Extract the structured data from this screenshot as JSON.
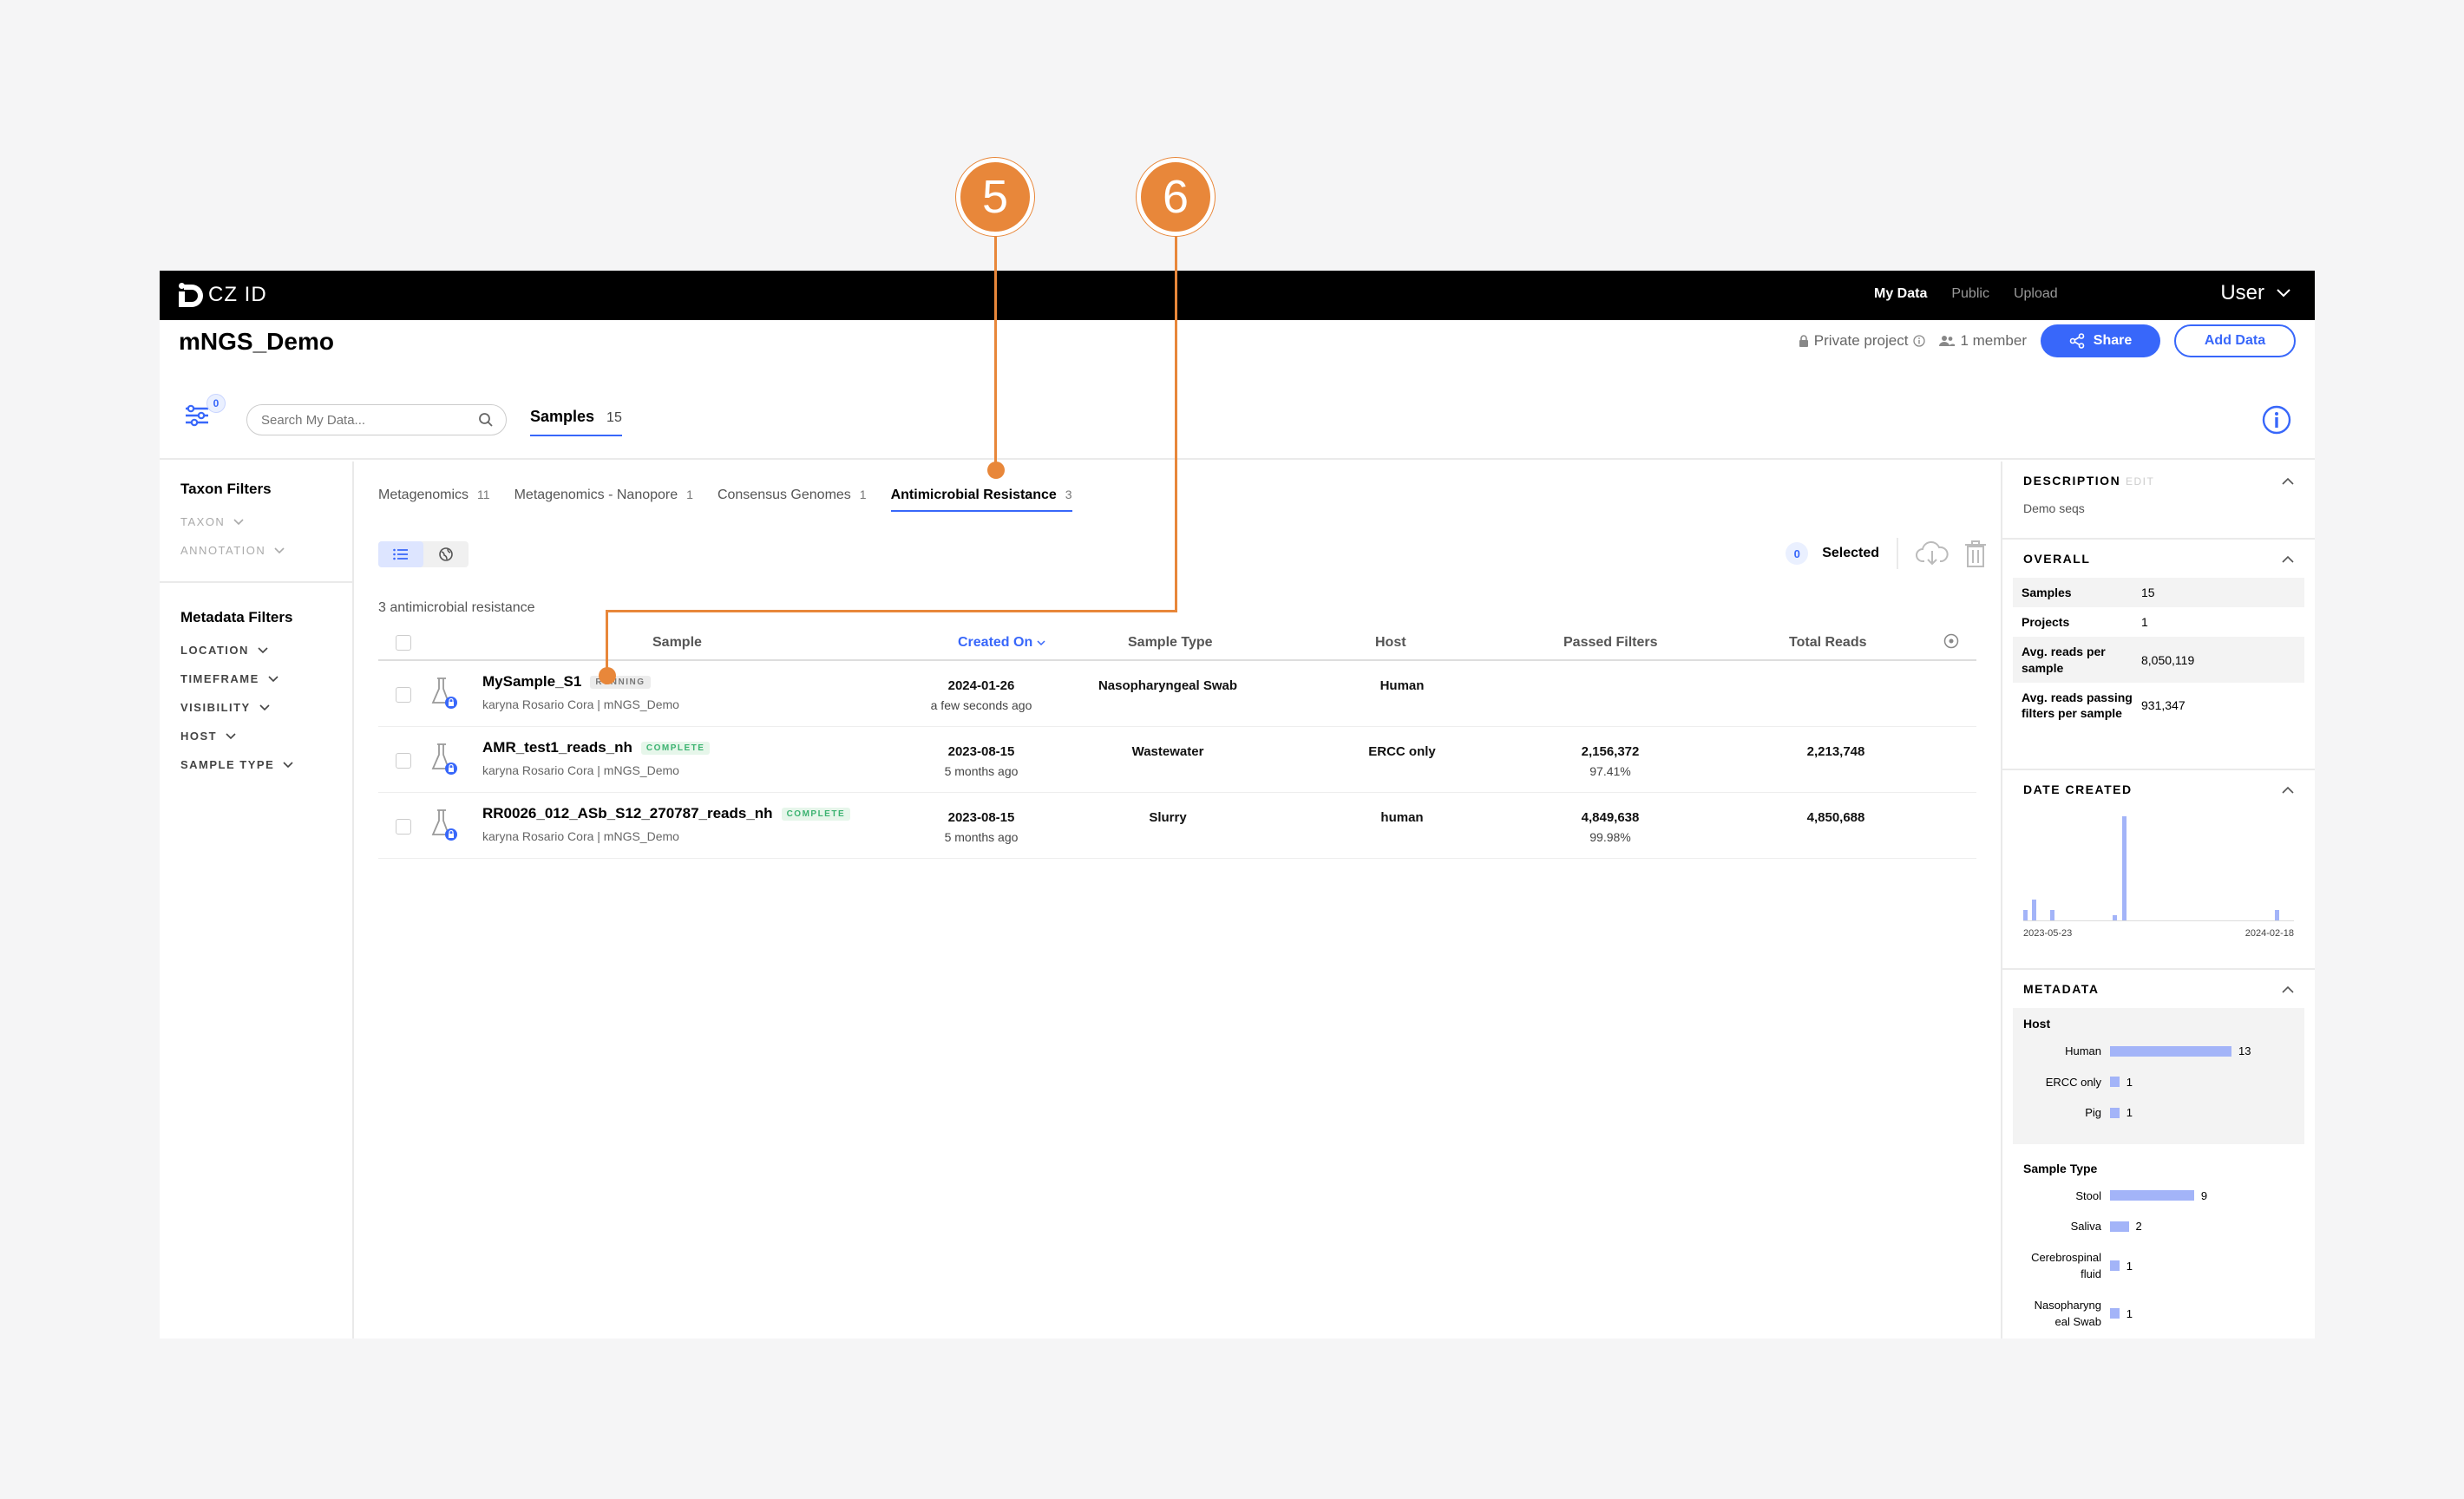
{
  "app": {
    "logo_main": "CZ",
    "logo_suffix": " ID",
    "nav": [
      "My Data",
      "Public",
      "Upload"
    ],
    "user": "User"
  },
  "project": {
    "title": "mNGS_Demo",
    "privacy": "Private project",
    "members": "1 member",
    "share_label": "Share",
    "add_data_label": "Add Data"
  },
  "toolbar": {
    "filter_count": "0",
    "search_placeholder": "Search My Data...",
    "samples_tab": "Samples",
    "samples_count": "15"
  },
  "left_panel": {
    "taxon_title": "Taxon Filters",
    "taxon_filters": [
      "TAXON",
      "ANNOTATION"
    ],
    "metadata_title": "Metadata Filters",
    "metadata_filters": [
      "LOCATION",
      "TIMEFRAME",
      "VISIBILITY",
      "HOST",
      "SAMPLE TYPE"
    ]
  },
  "workflow_tabs": [
    {
      "label": "Metagenomics",
      "count": "11"
    },
    {
      "label": "Metagenomics - Nanopore",
      "count": "1"
    },
    {
      "label": "Consensus Genomes",
      "count": "1"
    },
    {
      "label": "Antimicrobial Resistance",
      "count": "3"
    }
  ],
  "selection": {
    "count": "0",
    "label": "Selected"
  },
  "result_count": "3 antimicrobial resistance",
  "table": {
    "columns": [
      "Sample",
      "Created On",
      "Sample Type",
      "Host",
      "Passed Filters",
      "Total Reads"
    ],
    "rows": [
      {
        "name": "MySample_S1",
        "status": "RUNNING",
        "status_kind": "running",
        "sub": "karyna Rosario Cora | mNGS_Demo",
        "date": "2024-01-26",
        "ago": "a few seconds ago",
        "type": "Nasopharyngeal Swab",
        "host": "Human",
        "passed": "",
        "passed_pct": "",
        "total": ""
      },
      {
        "name": "AMR_test1_reads_nh",
        "status": "COMPLETE",
        "status_kind": "complete",
        "sub": "karyna Rosario Cora | mNGS_Demo",
        "date": "2023-08-15",
        "ago": "5 months ago",
        "type": "Wastewater",
        "host": "ERCC only",
        "passed": "2,156,372",
        "passed_pct": "97.41%",
        "total": "2,213,748"
      },
      {
        "name": "RR0026_012_ASb_S12_270787_reads_nh",
        "status": "COMPLETE",
        "status_kind": "complete",
        "sub": "karyna Rosario Cora | mNGS_Demo",
        "date": "2023-08-15",
        "ago": "5 months ago",
        "type": "Slurry",
        "host": "human",
        "passed": "4,849,638",
        "passed_pct": "99.98%",
        "total": "4,850,688"
      }
    ]
  },
  "right_panel": {
    "description_title": "DESCRIPTION",
    "edit": "EDIT",
    "description": "Demo seqs",
    "overall_title": "OVERALL",
    "overall": [
      {
        "k": "Samples",
        "v": "15"
      },
      {
        "k": "Projects",
        "v": "1"
      },
      {
        "k": "Avg. reads per sample",
        "v": "8,050,119"
      },
      {
        "k": "Avg. reads passing filters per sample",
        "v": "931,347"
      }
    ],
    "date_title": "DATE CREATED",
    "date_start": "2023-05-23",
    "date_end": "2024-02-18",
    "date_histogram": [
      2,
      4,
      0,
      2,
      0,
      0,
      0,
      0,
      0,
      0,
      1,
      20,
      0,
      0,
      0,
      0,
      0,
      0,
      0,
      0,
      0,
      0,
      0,
      0,
      0,
      0,
      0,
      0,
      2
    ],
    "metadata_title": "METADATA",
    "host_title": "Host",
    "host": [
      {
        "label": "Human",
        "n": 13
      },
      {
        "label": "ERCC only",
        "n": 1
      },
      {
        "label": "Pig",
        "n": 1
      }
    ],
    "sample_type_title": "Sample Type",
    "sample_type": [
      {
        "label": "Stool",
        "n": 9
      },
      {
        "label": "Saliva",
        "n": 2
      },
      {
        "label": "Cerebrospinal fluid",
        "n": 1
      },
      {
        "label": "Nasopharyng eal Swab",
        "n": 1
      }
    ]
  },
  "callouts": [
    "5",
    "6"
  ],
  "colors": {
    "accent": "#3867fa",
    "callout": "#e8873a",
    "bar": "#a3b4f8"
  }
}
